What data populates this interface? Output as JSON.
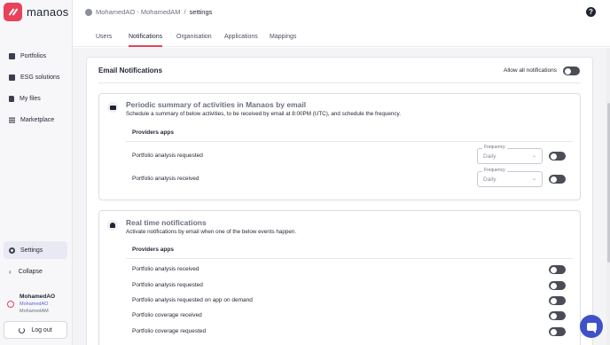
{
  "app": {
    "name": "manaos"
  },
  "sidebar": {
    "items": [
      {
        "label": "Portfolios"
      },
      {
        "label": "ESG solutions"
      },
      {
        "label": "My files"
      },
      {
        "label": "Marketplace"
      }
    ],
    "settings_label": "Settings",
    "collapse_label": "Collapse",
    "user": {
      "name": "MohamedAO",
      "handle": "MohamedAO",
      "org": "MohamedAM"
    },
    "logout_label": "Log out"
  },
  "header": {
    "breadcrumb_user": "MohamedAO - MohamedAM",
    "breadcrumb_sep": "/",
    "breadcrumb_page": "settings",
    "help_glyph": "?"
  },
  "tabs": [
    {
      "label": "Users",
      "active": false
    },
    {
      "label": "Notifications",
      "active": true
    },
    {
      "label": "Organisation",
      "active": false
    },
    {
      "label": "Applications",
      "active": false
    },
    {
      "label": "Mappings",
      "active": false
    }
  ],
  "email_notifications": {
    "title": "Email Notifications",
    "allow_all_label": "Allow all notifications",
    "allow_all_on": false,
    "periodic": {
      "title": "Periodic summary of activities in Manaos by email",
      "description": "Schedule a summary of below activities, to be received by email at 8:00PM (UTC), and schedule the frequency.",
      "group_label": "Providers apps",
      "rows": [
        {
          "label": "Portfolio analysis requested",
          "frequency_legend": "Frequency",
          "frequency": "Daily",
          "enabled": false
        },
        {
          "label": "Portfolio analysis received",
          "frequency_legend": "Frequency",
          "frequency": "Daily",
          "enabled": false
        }
      ]
    },
    "realtime": {
      "title": "Real time notifications",
      "description": "Activate notifications by email when one of the below events happen.",
      "group_label": "Providers apps",
      "rows": [
        {
          "label": "Portfolio analysis received",
          "enabled": false
        },
        {
          "label": "Portfolio analysis requested",
          "enabled": false
        },
        {
          "label": "Portfolio analysis requested on app on demand",
          "enabled": false
        },
        {
          "label": "Portfolio coverage received",
          "enabled": false
        },
        {
          "label": "Portfolio coverage requested",
          "enabled": false
        }
      ]
    }
  },
  "icons": {
    "logo": "manaos-logo-icon",
    "portfolios": "folder-icon",
    "esg": "esg-icon",
    "files": "file-icon",
    "marketplace": "grid-icon",
    "settings": "gear-icon",
    "collapse": "chevron-left-icon",
    "logout": "power-icon",
    "help": "help-icon",
    "chat": "chat-icon"
  },
  "colors": {
    "accent": "#e8415a",
    "toggle_off": "#4a4d57",
    "chat": "#3f51c9"
  }
}
